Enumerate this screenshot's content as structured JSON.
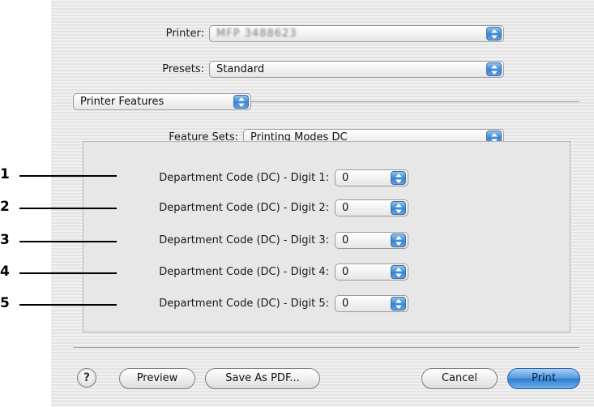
{
  "printer": {
    "label": "Printer:",
    "value": "MFP 3488623",
    "icon": "popup-arrows-icon"
  },
  "presets": {
    "label": "Presets:",
    "value": "Standard"
  },
  "panel_popup": {
    "value": "Printer Features"
  },
  "feature_sets": {
    "label": "Feature Sets:",
    "value": "Printing Modes DC"
  },
  "digits": [
    {
      "callout": "1",
      "label": "Department Code (DC) - Digit 1:",
      "value": "0"
    },
    {
      "callout": "2",
      "label": "Department Code (DC) - Digit 2:",
      "value": "0"
    },
    {
      "callout": "3",
      "label": "Department Code (DC) - Digit 3:",
      "value": "0"
    },
    {
      "callout": "4",
      "label": "Department Code (DC) - Digit 4:",
      "value": "0"
    },
    {
      "callout": "5",
      "label": "Department Code (DC) - Digit 5:",
      "value": "0"
    }
  ],
  "buttons": {
    "help": "?",
    "preview": "Preview",
    "save_pdf": "Save As PDF...",
    "cancel": "Cancel",
    "print": "Print"
  },
  "colors": {
    "accent": "#3a84cf",
    "background": "#e9e9e9"
  }
}
